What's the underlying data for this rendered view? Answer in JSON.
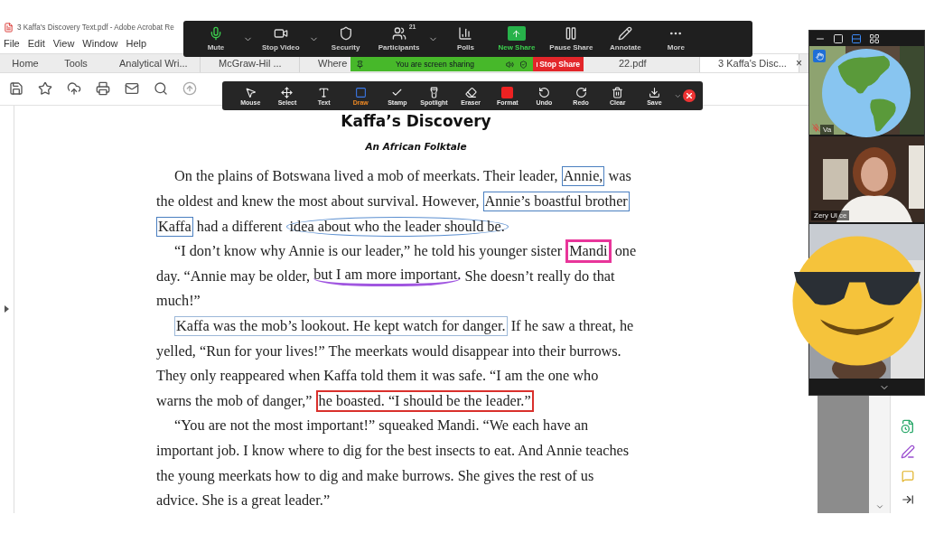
{
  "acrobat": {
    "title": "3 Kaffa's Discovery Text.pdf - Adobe Acrobat Re",
    "menu": [
      "File",
      "Edit",
      "View",
      "Window",
      "Help"
    ],
    "tabs": [
      {
        "label": "Home",
        "selected": false
      },
      {
        "label": "Tools",
        "selected": false
      },
      {
        "label": "Analytical Wri...",
        "selected": false
      },
      {
        "label": "McGraw-Hil ...",
        "selected": false
      },
      {
        "label": "Where",
        "selected": false
      },
      {
        "label": "22.pdf",
        "selected": false
      },
      {
        "label": "3 Kaffa's Disc...",
        "selected": true,
        "close": "×"
      }
    ]
  },
  "document": {
    "title": "Kaffa’s Discovery",
    "subtitle": "An African Folktale",
    "lines": [
      {
        "indent": true,
        "segments": [
          {
            "text": "On the plains of Botswana lived a mob of meerkats. Their leader, ",
            "kind": "plain"
          },
          {
            "text": "Annie,",
            "kind": "box",
            "color": "#4a7fc0"
          },
          {
            "text": " was",
            "kind": "plain"
          }
        ]
      },
      {
        "indent": false,
        "segments": [
          {
            "text": "the oldest and knew the most about survival. However, ",
            "kind": "plain"
          },
          {
            "text": "Annie’s boastful brother",
            "kind": "box",
            "color": "#4a7fc0"
          }
        ]
      },
      {
        "indent": false,
        "segments": [
          {
            "text": "Kaffa",
            "kind": "box",
            "color": "#4a7fc0"
          },
          {
            "text": " had a different ",
            "kind": "plain"
          },
          {
            "text": "idea about who the leader should be.",
            "kind": "ellipse",
            "color": "#5b8fd0"
          }
        ]
      },
      {
        "indent": true,
        "segments": [
          {
            "text": "“I don’t know why Annie is our leader,” he told his younger sister ",
            "kind": "plain"
          },
          {
            "text": "Mandi",
            "kind": "box",
            "color": "#e8359a"
          },
          {
            "text": " one",
            "kind": "plain"
          }
        ]
      },
      {
        "indent": false,
        "segments": [
          {
            "text": "day. “Annie may be older, ",
            "kind": "plain"
          },
          {
            "text": "but I am more important.",
            "kind": "underline",
            "color": "#a056e0"
          },
          {
            "text": " She doesn’t really do that",
            "kind": "plain"
          }
        ]
      },
      {
        "indent": false,
        "segments": [
          {
            "text": "much!”",
            "kind": "plain"
          }
        ]
      },
      {
        "indent": true,
        "segments": [
          {
            "text": "Kaffa was the mob’s lookout. He kept watch for danger.",
            "kind": "box",
            "color": "#9cb8d8"
          },
          {
            "text": " If he saw a threat, he",
            "kind": "plain"
          }
        ]
      },
      {
        "indent": false,
        "segments": [
          {
            "text": "yelled, “Run for your lives!” The meerkats would disappear into their burrows.",
            "kind": "plain"
          }
        ]
      },
      {
        "indent": false,
        "segments": [
          {
            "text": "They only reappeared when Kaffa told them it was safe. “I am the one who",
            "kind": "plain"
          }
        ]
      },
      {
        "indent": false,
        "segments": [
          {
            "text": "warns the mob of danger,” ",
            "kind": "plain"
          },
          {
            "text": "he boasted. “I should be the leader.”",
            "kind": "box",
            "color": "#d9302c"
          }
        ]
      },
      {
        "indent": true,
        "segments": [
          {
            "text": "“You are not the most important!” squeaked Mandi. “We each have an",
            "kind": "plain"
          }
        ]
      },
      {
        "indent": false,
        "segments": [
          {
            "text": "important job. I know where to dig for the best insects to eat. And Annie teaches",
            "kind": "plain"
          }
        ]
      },
      {
        "indent": false,
        "segments": [
          {
            "text": "the young meerkats how to dig and make burrows. She gives the rest of us",
            "kind": "plain"
          }
        ]
      },
      {
        "indent": false,
        "segments": [
          {
            "text": "advice. She is a great leader.”",
            "kind": "plain"
          }
        ]
      }
    ]
  },
  "meeting_controls": [
    {
      "label": "Mute",
      "has_menu": true
    },
    {
      "label": "Stop Video",
      "has_menu": true
    },
    {
      "label": "Security",
      "has_menu": false
    },
    {
      "label": "Participants",
      "count": "21",
      "has_menu": true
    },
    {
      "label": "Polls",
      "has_menu": false
    },
    {
      "label": "New Share",
      "has_menu": false
    },
    {
      "label": "Pause Share",
      "has_menu": false
    },
    {
      "label": "Annotate",
      "has_menu": false
    },
    {
      "label": "More",
      "has_menu": false
    }
  ],
  "sharing_bar": {
    "status": "You are screen sharing",
    "stop": "Stop Share"
  },
  "annotation_tools": [
    {
      "label": "Mouse",
      "selected": false
    },
    {
      "label": "Select",
      "selected": false
    },
    {
      "label": "Text",
      "selected": false
    },
    {
      "label": "Draw",
      "selected": true
    },
    {
      "label": "Stamp",
      "selected": false
    },
    {
      "label": "Spotlight",
      "selected": false
    },
    {
      "label": "Eraser",
      "selected": false
    },
    {
      "label": "Format",
      "selected": false
    },
    {
      "label": "Undo",
      "selected": false
    },
    {
      "label": "Redo",
      "selected": false
    },
    {
      "label": "Clear",
      "selected": false
    },
    {
      "label": "Save",
      "selected": false
    }
  ],
  "video_panel": {
    "views": [
      {
        "selected": false
      },
      {
        "selected": false
      },
      {
        "selected": true
      },
      {
        "selected": false
      }
    ],
    "tiles": [
      {
        "name": "Va"
      },
      {
        "name": "Zery Ul ce"
      },
      {
        "kind": "picture"
      }
    ]
  }
}
